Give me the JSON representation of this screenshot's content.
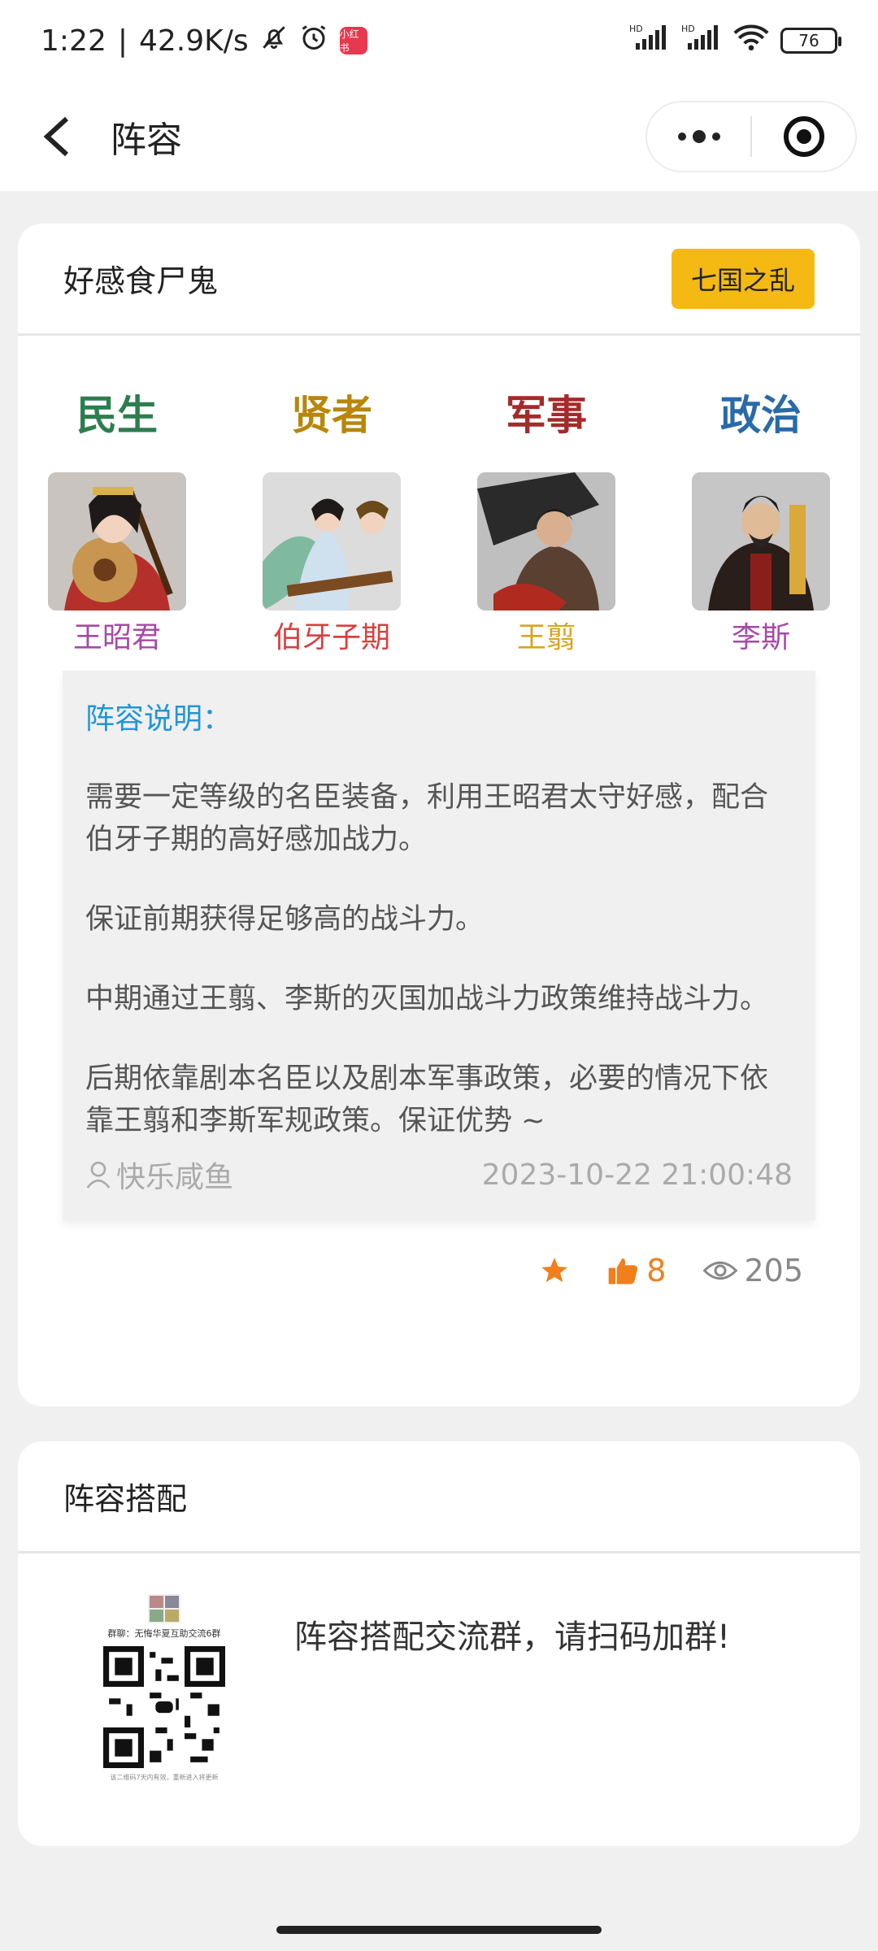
{
  "status_bar": {
    "time": "1:22",
    "net_speed": "42.9K/s",
    "app_badge": "小红书",
    "signal_label_1": "HD",
    "signal_label_2": "HD",
    "battery": "76"
  },
  "nav": {
    "title": "阵容"
  },
  "lineup": {
    "title": "好感食尸鬼",
    "tag": "七国之乱",
    "categories": [
      {
        "label": "民生",
        "color": "#2e7d4f"
      },
      {
        "label": "贤者",
        "color": "#b8860b"
      },
      {
        "label": "军事",
        "color": "#a52a2a"
      },
      {
        "label": "政治",
        "color": "#2a6aa8"
      }
    ],
    "heroes": [
      {
        "name": "王昭君",
        "color": "#a64aa6"
      },
      {
        "name": "伯牙子期",
        "color": "#d94040"
      },
      {
        "name": "王翦",
        "color": "#d9a520"
      },
      {
        "name": "李斯",
        "color": "#a64aa6"
      }
    ],
    "description": {
      "title": "阵容说明：",
      "paragraphs": [
        "需要一定等级的名臣装备，利用王昭君太守好感，配合伯牙子期的高好感加战力。",
        "保证前期获得足够高的战斗力。",
        "中期通过王翦、李斯的灭国加战斗力政策维持战斗力。",
        "后期依靠剧本名臣以及剧本军事政策，必要的情况下依靠王翦和李斯军规政策。保证优势 ~"
      ],
      "author": "快乐咸鱼",
      "timestamp": "2023-10-22 21:00:48"
    },
    "stats": {
      "likes": "8",
      "views": "205"
    }
  },
  "lineup_match": {
    "title": "阵容搭配",
    "qr_caption": "群聊：无悔华夏互助交流6群",
    "qr_footer": "该二维码7天内有效，重新进入将更新",
    "text": "阵容搭配交流群，请扫码加群!"
  }
}
